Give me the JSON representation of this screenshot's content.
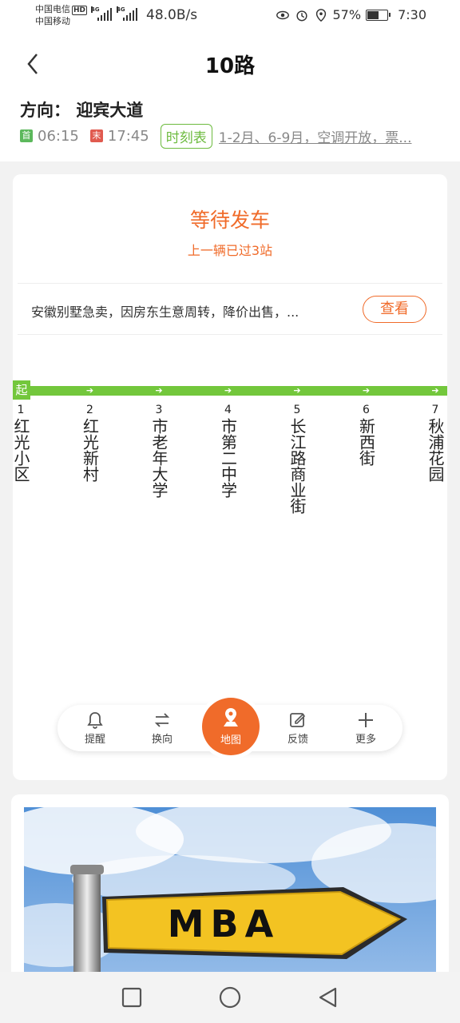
{
  "status_bar": {
    "carrier1": "中国电信",
    "carrier2": "中国移动",
    "hd": "HD",
    "signal_gen": "4G",
    "net_speed": "48.0B/s",
    "battery_percent": "57%",
    "battery_level": 0.57,
    "time": "7:30"
  },
  "header": {
    "title": "10路",
    "direction_label": "方向：",
    "direction_value": "迎宾大道",
    "first_tag": "首",
    "first_time": "06:15",
    "last_tag": "末",
    "last_time": "17:45",
    "schedule_label": "时刻表",
    "notice": "1-2月、6-9月，空调开放，票..."
  },
  "status": {
    "title": "等待发车",
    "subtitle": "上一辆已过3站"
  },
  "ad_banner": {
    "text": "安徽别墅急卖，因房东生意周转，降价出售，...",
    "button": "查看"
  },
  "route": {
    "start_tag": "起",
    "line_color": "#73c73c",
    "stops": [
      {
        "num": "1",
        "name": "红光小区"
      },
      {
        "num": "2",
        "name": "红光新村"
      },
      {
        "num": "3",
        "name": "市老年大学"
      },
      {
        "num": "4",
        "name": "市第二中学"
      },
      {
        "num": "5",
        "name": "长江路商业街"
      },
      {
        "num": "6",
        "name": "新西街"
      },
      {
        "num": "7",
        "name": "秋浦花园"
      }
    ]
  },
  "toolbar": {
    "remind": "提醒",
    "switch": "换向",
    "map": "地图",
    "feedback": "反馈",
    "more": "更多",
    "accent_color": "#f06b2a"
  },
  "ad_image": {
    "sign_text": "MBA"
  },
  "nav": {
    "recent": "square-icon",
    "home": "circle-icon",
    "back": "triangle-icon"
  }
}
